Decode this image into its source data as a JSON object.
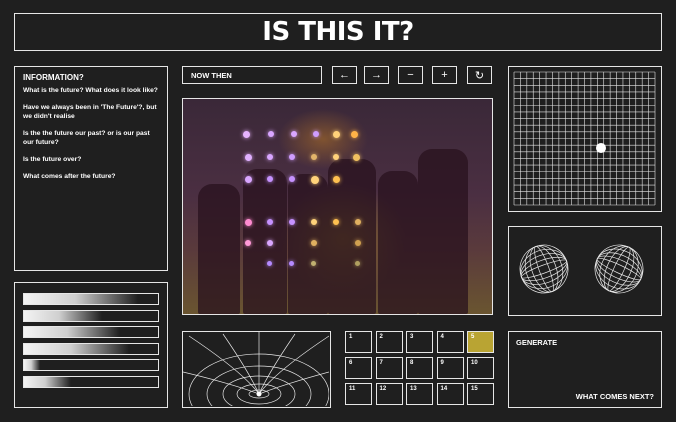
{
  "title": "IS THIS IT?",
  "info": {
    "heading": "INFORMATION?",
    "questions": [
      "What is the future? What does it look like?",
      "Have we always been in  'The Future'?, but we didn't realise",
      "Is the the future our past? or is our past our future?",
      "Is the future over?",
      "What comes after the future?"
    ]
  },
  "sliders": [
    0.85,
    0.58,
    0.72,
    0.78,
    0.12,
    0.35
  ],
  "toolbar": {
    "label": "NOW THEN",
    "buttons": [
      {
        "icon": "arrow-left-icon",
        "glyph": "←"
      },
      {
        "icon": "arrow-right-icon",
        "glyph": "→"
      },
      {
        "icon": "minus-icon",
        "glyph": "−"
      },
      {
        "icon": "plus-icon",
        "glyph": "+"
      },
      {
        "icon": "reset-icon",
        "glyph": "↻"
      }
    ]
  },
  "keypad": {
    "keys": [
      "1",
      "2",
      "3",
      "4",
      "5",
      "6",
      "7",
      "8",
      "9",
      "10",
      "11",
      "12",
      "13",
      "14",
      "15"
    ],
    "active": "5"
  },
  "generate": {
    "heading": "GENERATE",
    "next": "WHAT COMES NEXT?"
  },
  "colors": {
    "background": "#1f1f1f",
    "stroke": "#e6e6e6",
    "accent": "#b9a433"
  }
}
